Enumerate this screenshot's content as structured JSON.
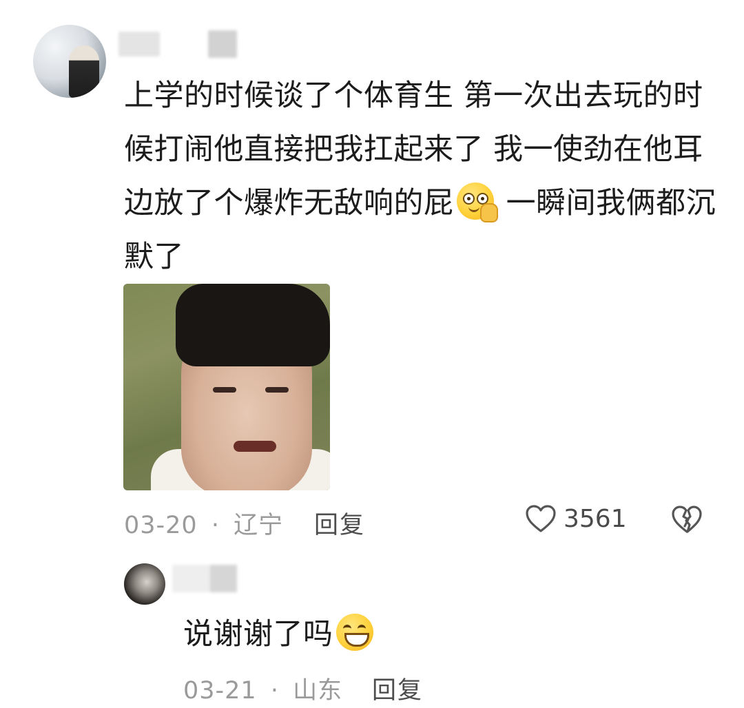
{
  "comment": {
    "avatar_icon": "avatar-icon",
    "text_before_emoji": "上学的时候谈了个体育生 第一次出去玩的时候打闹他直接把我扛起来了 我一使劲在他耳边放了个爆炸无敌响的屁",
    "emoji_1": "thinking-face-emoji",
    "text_after_emoji": " 一瞬间我俩都沉默了",
    "image_icon": "meme-image",
    "date": "03-20",
    "separator": "·",
    "location": "辽宁",
    "reply_label": "回复",
    "like_icon": "heart-icon",
    "like_count": "3561",
    "dislike_icon": "broken-heart-icon"
  },
  "reply": {
    "avatar_icon": "avatar-icon",
    "text": "说谢谢了吗",
    "emoji": "grinning-face-emoji",
    "date": "03-21",
    "separator": "·",
    "location": "山东",
    "reply_label": "回复"
  }
}
